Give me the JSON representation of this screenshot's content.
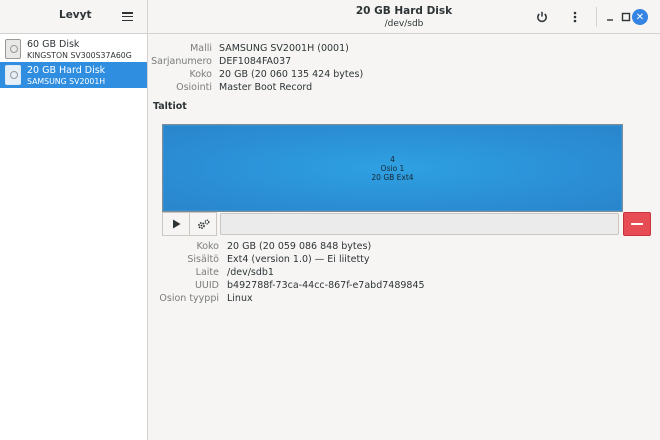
{
  "sidebar_header": {
    "title": "Levyt"
  },
  "window": {
    "title": "20 GB Hard Disk",
    "subtitle": "/dev/sdb"
  },
  "disks": [
    {
      "name": "60 GB Disk",
      "model": "KINGSTON SV300S37A60G",
      "selected": false
    },
    {
      "name": "20 GB Hard Disk",
      "model": "SAMSUNG SV2001H",
      "selected": true
    }
  ],
  "drive_info": {
    "model_label": "Malli",
    "model_value": "SAMSUNG SV2001H (0001)",
    "serial_label": "Sarjanumero",
    "serial_value": "DEF1084FA037",
    "size_label": "Koko",
    "size_value": "20 GB (20 060 135 424 bytes)",
    "partitioning_label": "Osiointi",
    "partitioning_value": "Master Boot Record"
  },
  "volumes_title": "Taltiot",
  "volume": {
    "line1": "4",
    "line2": "Osio 1",
    "line3": "20 GB Ext4"
  },
  "partition_info": {
    "size_label": "Koko",
    "size_value": "20 GB (20 059 086 848 bytes)",
    "contents_label": "Sisältö",
    "contents_value": "Ext4 (version 1.0) — Ei liitetty",
    "device_label": "Laite",
    "device_value": "/dev/sdb1",
    "uuid_label": "UUID",
    "uuid_value": "b492788f-73ca-44cc-867f-e7abd7489845",
    "type_label": "Osion tyyppi",
    "type_value": "Linux"
  },
  "icons": {
    "menu": "hamburger-menu-icon",
    "power": "power-icon",
    "more": "vertical-dots-icon",
    "minimize": "minimize-icon",
    "maximize": "maximize-icon",
    "close": "close-icon",
    "play": "play-icon",
    "gears": "gears-icon",
    "remove": "minus-icon",
    "disk": "hard-disk-icon"
  },
  "colors": {
    "accent": "#2f8ee0",
    "volume": "#2b8fd6",
    "danger": "#e74c55",
    "close": "#3584e4"
  }
}
